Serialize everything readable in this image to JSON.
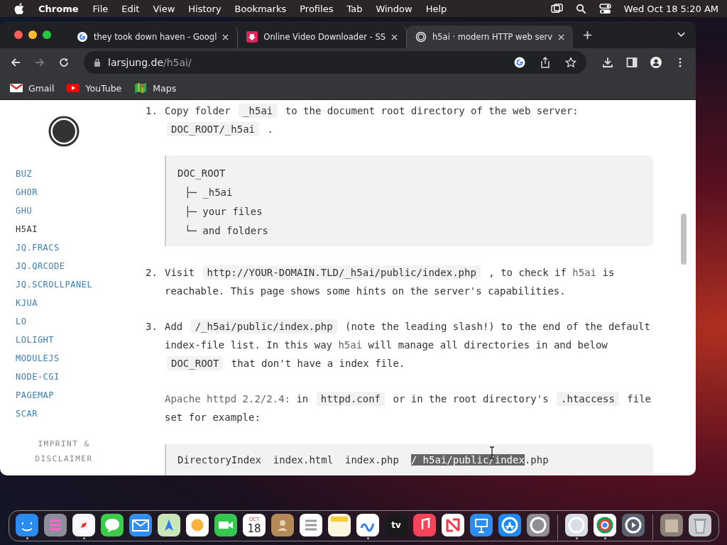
{
  "menu_bar": {
    "app": "Chrome",
    "menus": [
      "File",
      "Edit",
      "View",
      "History",
      "Bookmarks",
      "Profiles",
      "Tab",
      "Window",
      "Help"
    ],
    "clock": "Wed Oct 18  5:20 AM"
  },
  "browser": {
    "tabs": [
      {
        "title": "they took down haven - Googl",
        "selected": false
      },
      {
        "title": "Online Video Downloader - SS",
        "selected": false
      },
      {
        "title": "h5ai · modern HTTP web serv",
        "selected": true
      }
    ],
    "address": {
      "host": "larsjung.de",
      "path": "/h5ai/"
    },
    "bookmarks": [
      {
        "label": "Gmail"
      },
      {
        "label": "YouTube"
      },
      {
        "label": "Maps"
      }
    ]
  },
  "sidebar": {
    "links": [
      {
        "label": "BUZ",
        "selected": false
      },
      {
        "label": "GHOR",
        "selected": false
      },
      {
        "label": "GHU",
        "selected": false
      },
      {
        "label": "H5AI",
        "selected": true
      },
      {
        "label": "JQ.FRACS",
        "selected": false
      },
      {
        "label": "JQ.QRCODE",
        "selected": false
      },
      {
        "label": "JQ.SCROLLPANEL",
        "selected": false
      },
      {
        "label": "KJUA",
        "selected": false
      },
      {
        "label": "LO",
        "selected": false
      },
      {
        "label": "LOLIGHT",
        "selected": false
      },
      {
        "label": "MODULEJS",
        "selected": false
      },
      {
        "label": "NODE-CGI",
        "selected": false
      },
      {
        "label": "PAGEMAP",
        "selected": false
      },
      {
        "label": "SCAR",
        "selected": false
      }
    ],
    "footer": "IMPRINT & DISCLAIMER"
  },
  "content": [
    {
      "kind": "step",
      "number": "1.",
      "segments": [
        {
          "kind": "text",
          "text": "Copy folder "
        },
        {
          "kind": "code",
          "text": "_h5ai"
        },
        {
          "kind": "text",
          "text": " to the document root directory of the web server: "
        },
        {
          "kind": "code",
          "text": "DOC_ROOT/_h5ai"
        },
        {
          "kind": "text",
          "text": " ."
        }
      ]
    },
    {
      "kind": "tree",
      "root": "DOC_ROOT",
      "children": [
        {
          "branch": "├─",
          "label": "_h5ai"
        },
        {
          "branch": "├─",
          "label": "your files"
        },
        {
          "branch": "└─",
          "label": "and folders"
        }
      ]
    },
    {
      "kind": "step",
      "number": "2.",
      "segments": [
        {
          "kind": "text",
          "text": "Visit "
        },
        {
          "kind": "code",
          "text": "http://YOUR-DOMAIN.TLD/_h5ai/public/index.php"
        },
        {
          "kind": "text",
          "text": " , to check if "
        },
        {
          "kind": "muted",
          "text": "h5ai"
        },
        {
          "kind": "text",
          "text": " is reachable. This page shows some hints on the server's capabilities."
        }
      ]
    },
    {
      "kind": "step",
      "number": "3.",
      "segments": [
        {
          "kind": "text",
          "text": "Add "
        },
        {
          "kind": "code",
          "text": "/_h5ai/public/index.php"
        },
        {
          "kind": "text",
          "text": " (note the leading slash!) to the end of the default index-file list. In this way "
        },
        {
          "kind": "muted",
          "text": "h5ai"
        },
        {
          "kind": "text",
          "text": " will manage all directories in and below "
        },
        {
          "kind": "code",
          "text": "DOC_ROOT"
        },
        {
          "kind": "text",
          "text": " that don't have a index file."
        }
      ]
    },
    {
      "kind": "note",
      "segments": [
        {
          "kind": "muted",
          "text": "Apache httpd 2.2/2.4:"
        },
        {
          "kind": "text",
          "text": " in "
        },
        {
          "kind": "code",
          "text": "httpd.conf"
        },
        {
          "kind": "text",
          "text": " or in the root directory's "
        },
        {
          "kind": "code",
          "text": ".htaccess"
        },
        {
          "kind": "text",
          "text": " file set for example:"
        }
      ]
    },
    {
      "kind": "code",
      "segments": [
        {
          "text": "DirectoryIndex  index.html  index.php  ",
          "selected": false
        },
        {
          "text": "/_h5ai/public/index",
          "selected": true
        },
        {
          "text": ".php",
          "selected": false
        }
      ]
    }
  ],
  "dock": {
    "groups": [
      [
        {
          "kind": "finder",
          "running": true
        },
        {
          "kind": "launchpad",
          "running": false
        },
        {
          "kind": "safari",
          "running": true
        },
        {
          "kind": "messages",
          "running": false
        },
        {
          "kind": "mail",
          "running": false
        },
        {
          "kind": "maps",
          "running": false
        },
        {
          "kind": "photos",
          "running": false
        },
        {
          "kind": "facetime",
          "running": false
        },
        {
          "kind": "calendar",
          "running": false,
          "month": "OCT",
          "day": "18"
        },
        {
          "kind": "contacts",
          "running": false
        },
        {
          "kind": "reminders",
          "running": false
        },
        {
          "kind": "notes",
          "running": false
        },
        {
          "kind": "freeform",
          "running": true
        },
        {
          "kind": "tv",
          "running": false,
          "label": "tv"
        },
        {
          "kind": "music",
          "running": false
        },
        {
          "kind": "news",
          "running": false
        },
        {
          "kind": "keynote",
          "running": false
        },
        {
          "kind": "appstore",
          "running": false
        },
        {
          "kind": "settings",
          "running": false
        }
      ],
      [
        {
          "kind": "prefs",
          "running": true
        },
        {
          "kind": "chrome",
          "running": true
        },
        {
          "kind": "quicktime",
          "running": false
        }
      ],
      [
        {
          "kind": "stack",
          "running": false
        },
        {
          "kind": "trash",
          "running": false
        }
      ]
    ]
  }
}
